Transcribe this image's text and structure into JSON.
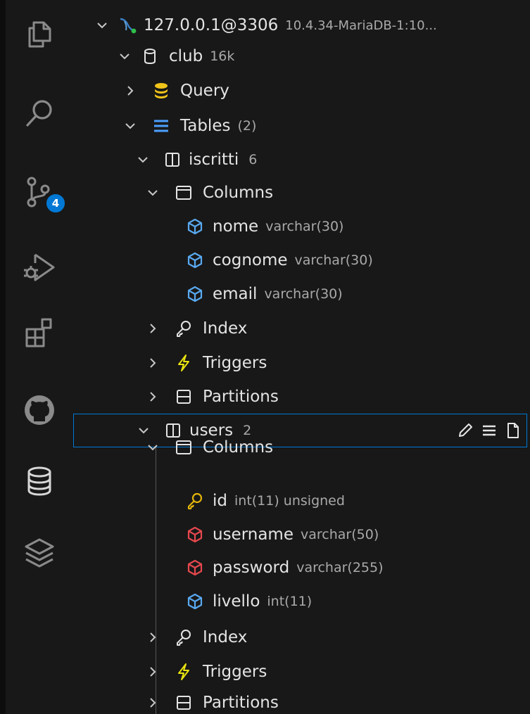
{
  "colors": {
    "background": "#181818",
    "text": "#e4e4e4",
    "description": "#a9a9a9",
    "accent": "#0078d4",
    "query_icon": "#f0c419",
    "tables_icon": "#4c9fff",
    "column_icon": "#59a9f0",
    "unique_column_icon": "#e5484d",
    "primary_key_icon": "#e2b40b",
    "trigger_icon": "#e8e30f"
  },
  "activity_bar": {
    "items": [
      {
        "icon": "explorer-icon"
      },
      {
        "icon": "search-icon"
      },
      {
        "icon": "source-control-icon",
        "badge": "4"
      },
      {
        "icon": "run-debug-icon"
      },
      {
        "icon": "extensions-icon"
      },
      {
        "icon": "github-icon"
      },
      {
        "icon": "database-icon"
      },
      {
        "icon": "layers-icon"
      }
    ]
  },
  "tree": {
    "connection": {
      "label": "127.0.0.1@3306",
      "description": "10.4.34-MariaDB-1:10..."
    },
    "database": {
      "label": "club",
      "description": "16k"
    },
    "query": {
      "label": "Query"
    },
    "tables": {
      "label": "Tables",
      "description": "(2)"
    },
    "table1": {
      "label": "iscritti",
      "description": "6",
      "columns_label": "Columns",
      "columns": [
        {
          "name": "nome",
          "type": "varchar(30)",
          "icon": "column-icon"
        },
        {
          "name": "cognome",
          "type": "varchar(30)",
          "icon": "column-icon"
        },
        {
          "name": "email",
          "type": "varchar(30)",
          "icon": "column-icon"
        }
      ],
      "index_label": "Index",
      "triggers_label": "Triggers",
      "partitions_label": "Partitions"
    },
    "table2": {
      "label": "users",
      "description": "2",
      "columns_label": "Columns",
      "columns": [
        {
          "name": "id",
          "type": "int(11) unsigned",
          "icon": "primary-key-icon"
        },
        {
          "name": "username",
          "type": "varchar(50)",
          "icon": "unique-column-icon"
        },
        {
          "name": "password",
          "type": "varchar(255)",
          "icon": "unique-column-icon"
        },
        {
          "name": "livello",
          "type": "int(11)",
          "icon": "column-icon"
        }
      ],
      "index_label": "Index",
      "triggers_label": "Triggers",
      "partitions_label": "Partitions"
    }
  }
}
